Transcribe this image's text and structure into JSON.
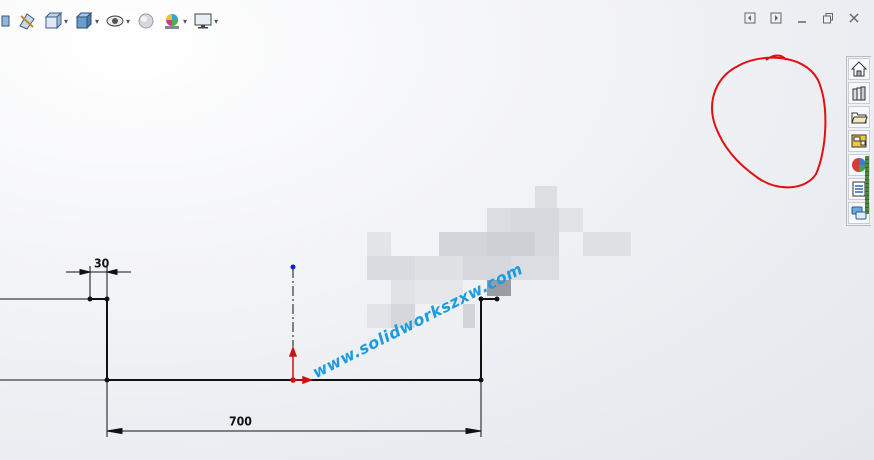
{
  "toolbar": {
    "buttons": [
      {
        "name": "view-orientation-icon",
        "has_dropdown": false
      },
      {
        "name": "section-view-icon",
        "has_dropdown": false
      },
      {
        "name": "view-settings-icon",
        "has_dropdown": true
      },
      {
        "name": "display-style-icon",
        "has_dropdown": true
      },
      {
        "name": "hide-show-items-icon",
        "has_dropdown": true
      },
      {
        "name": "edit-appearance-icon",
        "has_dropdown": false
      },
      {
        "name": "apply-scene-icon",
        "has_dropdown": true
      },
      {
        "name": "view-settings-monitor-icon",
        "has_dropdown": true
      }
    ]
  },
  "window_controls": [
    "tile-left-icon",
    "tile-right-icon",
    "minimize-icon",
    "restore-icon",
    "close-icon"
  ],
  "task_pane": [
    "home-icon",
    "design-library-icon",
    "file-explorer-icon",
    "view-palette-icon",
    "appearances-icon",
    "custom-properties-icon",
    "forum-icon"
  ],
  "sketch": {
    "dimensions": {
      "small": "30",
      "large": "700"
    }
  },
  "watermark": "www.solidworkszxw.com",
  "colors": {
    "sketch_line": "#111111",
    "origin": "#d01010",
    "point_blue": "#1020d0",
    "annotation": "#e01010",
    "watermark": "#1e9be0"
  }
}
